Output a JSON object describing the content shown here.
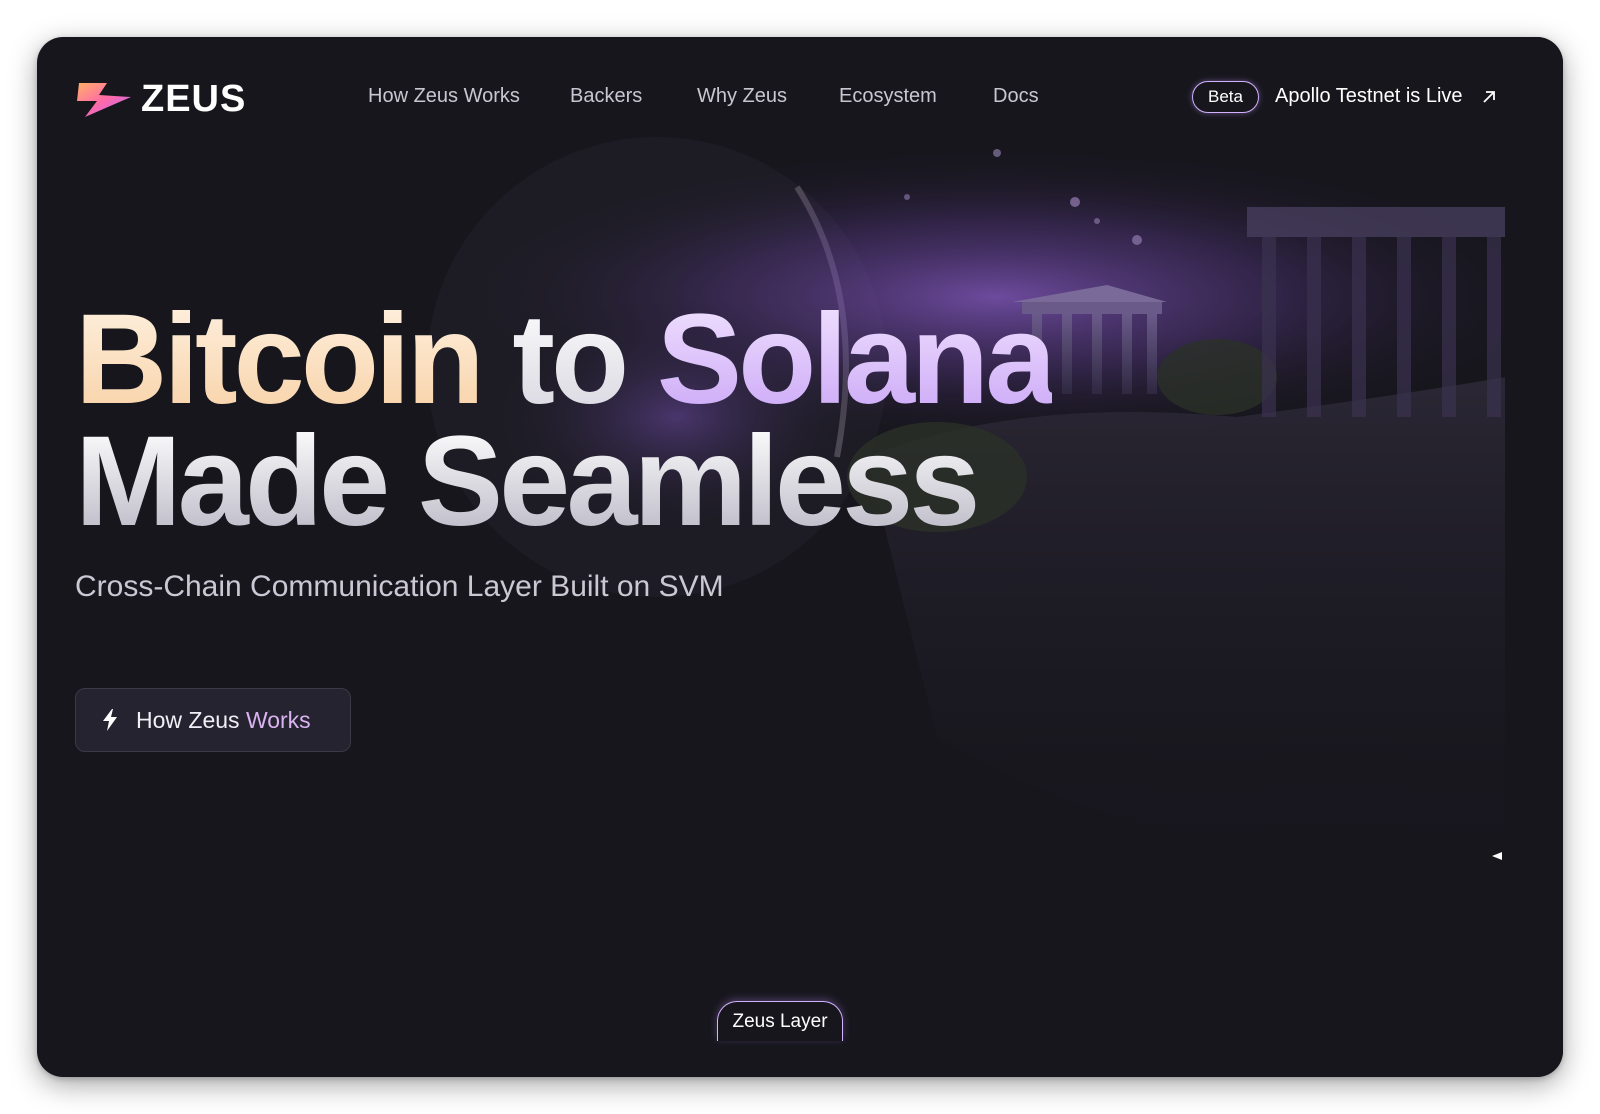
{
  "brand": {
    "name": "ZEUS",
    "logo_icon": "zeus-bolt-icon"
  },
  "nav": {
    "links": [
      {
        "label": "How Zeus Works"
      },
      {
        "label": "Backers"
      },
      {
        "label": "Why Zeus"
      },
      {
        "label": "Ecosystem"
      },
      {
        "label": "Docs"
      }
    ],
    "badge": "Beta",
    "announcement": "Apollo Testnet is Live",
    "announcement_icon": "arrow-up-right-icon"
  },
  "hero": {
    "headline": {
      "word1": "Bitcoin",
      "word2": "to",
      "word3": "Solana",
      "line2": "Made Seamless"
    },
    "subtitle": "Cross-Chain Communication Layer Built on SVM",
    "cta": {
      "label_part1": "How Zeus ",
      "label_part2": "Works",
      "icon": "lightning-icon"
    }
  },
  "footer_pill": "Zeus Layer",
  "colors": {
    "background": "#17161d",
    "accent_purple": "#c8a3f6",
    "accent_peach": "#f7cfa2",
    "badge_border": "#d3b2ff"
  }
}
